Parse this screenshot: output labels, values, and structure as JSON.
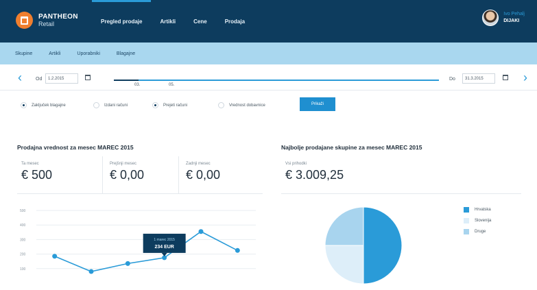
{
  "app": {
    "logo_name": "PANTHEON",
    "logo_sub": "Retail",
    "nav": [
      "Pregled prodaje",
      "Artikli",
      "Cene",
      "Prodaja"
    ],
    "user_name": "Ivo Pehalj",
    "user_role": "DIJAKI"
  },
  "subnav": [
    "Skupine",
    "Artikli",
    "Uporabniki",
    "Blagajne"
  ],
  "date_filter": {
    "from_label": "Od",
    "from_value": "1.2.2015",
    "to_label": "Do",
    "to_value": "31.3.2015",
    "ticks": [
      "03.",
      "05."
    ]
  },
  "options": {
    "radios": [
      {
        "label": "Zaključek blagajne",
        "checked": true
      },
      {
        "label": "Izdani računi",
        "checked": false
      },
      {
        "label": "Prejeti računi",
        "checked": true
      },
      {
        "label": "Vrednost dobavnice",
        "checked": false
      }
    ],
    "submit_label": "Prikaži"
  },
  "left_panel": {
    "title": "Prodajna vrednost za mesec MAREC 2015",
    "kpis": [
      {
        "label": "Ta mesec",
        "value": "€ 500"
      },
      {
        "label": "Prejšnji mesec",
        "value": "€ 0,00"
      },
      {
        "label": "Zadnji mesec",
        "value": "€ 0,00"
      }
    ]
  },
  "right_panel": {
    "title": "Najbolje prodajane skupine za mesec MAREC 2015",
    "kpi_label": "Vsi prihodki",
    "kpi_value": "€ 3.009,25"
  },
  "chart_data": [
    {
      "type": "line",
      "yticks": [
        "500",
        "400",
        "300",
        "200",
        "100"
      ],
      "ylim": [
        0,
        500
      ],
      "x": [
        1,
        2,
        3,
        4,
        5,
        6
      ],
      "values": [
        185,
        80,
        135,
        175,
        355,
        225
      ],
      "xlim": [
        0.5,
        6.5
      ],
      "tooltip": {
        "line1": "1 marec 2015",
        "line2": "234 EUR"
      },
      "color": "#2a9bd8"
    },
    {
      "type": "pie",
      "legend": [
        "Hrvatska",
        "Slovenija",
        "Druge"
      ],
      "values": [
        50,
        25,
        25
      ],
      "colors": [
        "#2a9bd8",
        "#ddeef9",
        "#a8d4ee"
      ]
    }
  ]
}
